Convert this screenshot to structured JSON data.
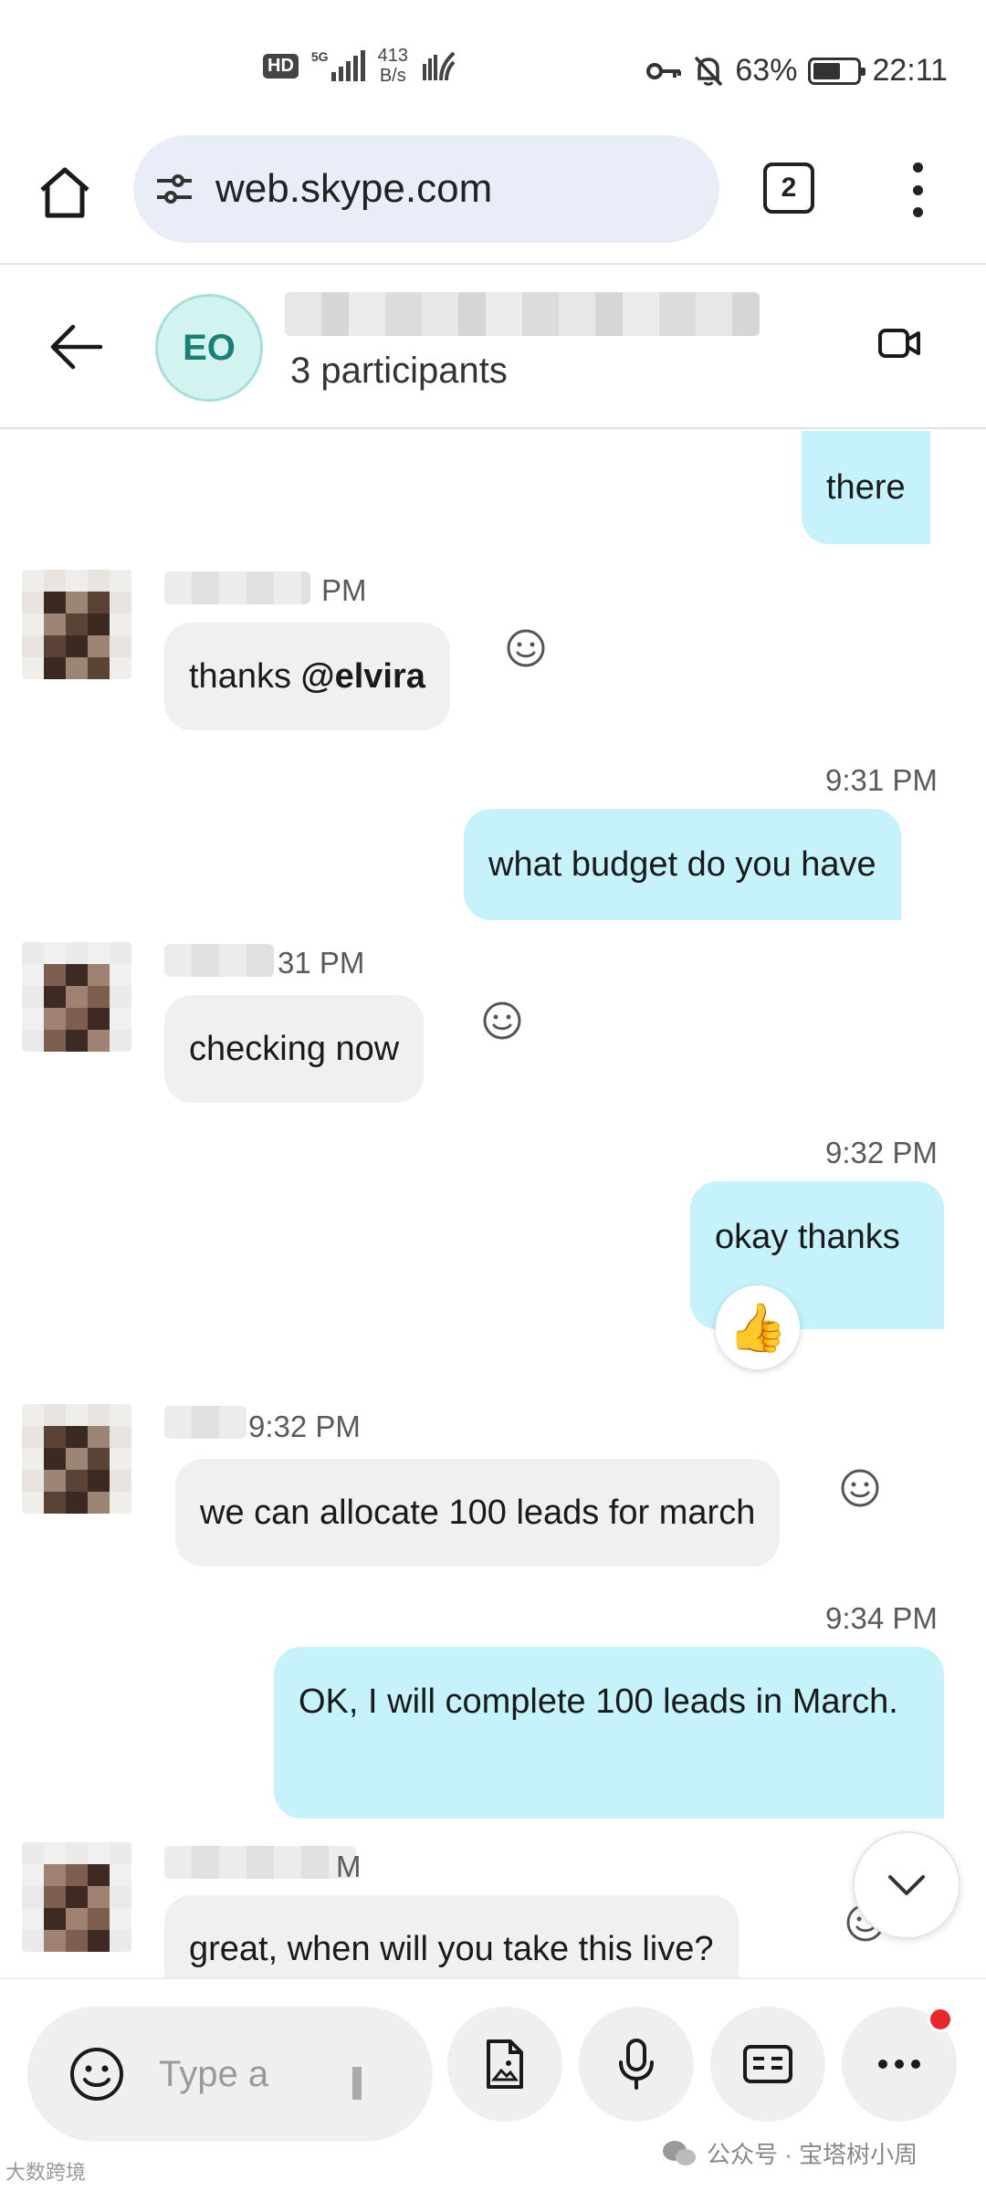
{
  "status_bar": {
    "network_badge": "HD",
    "network_type": "5G",
    "speed_value": "413",
    "speed_unit": "B/s",
    "battery": "63%",
    "battery_level": 0.63,
    "time": "22:11"
  },
  "browser": {
    "url": "web.skype.com",
    "tab_count": "2"
  },
  "conversation": {
    "avatar_initials": "EO",
    "subtitle": "3 participants"
  },
  "messages": [
    {
      "text": "there"
    },
    {
      "time": "PM",
      "text_prefix": "thanks ",
      "mention": "@elvira"
    },
    {
      "time": "9:31 PM",
      "text": "what budget do you have"
    },
    {
      "time": "31 PM",
      "text": "checking now"
    },
    {
      "time": "9:32 PM",
      "text": "okay thanks",
      "reaction": "👍"
    },
    {
      "time": "9:32 PM",
      "text": "we can allocate 100 leads for march"
    },
    {
      "time": "9:34 PM",
      "text": "OK, I will complete 100 leads in March."
    },
    {
      "time": "M",
      "text": "great, when will you take this live?"
    }
  ],
  "composer": {
    "placeholder": "Type a"
  },
  "watermark": {
    "right": "公众号 · 宝塔树小周",
    "left": "大数跨境"
  },
  "icons": {
    "home": "home-icon",
    "site_settings": "tune-icon",
    "menu": "more-vert-icon",
    "back": "arrow-left-icon",
    "video": "video-call-icon",
    "react": "smiley-icon",
    "scroll": "chevron-down-icon",
    "emoji": "emoji-icon",
    "media": "image-file-icon",
    "mic": "microphone-icon",
    "contact": "contact-card-icon",
    "more": "more-horiz-icon"
  }
}
